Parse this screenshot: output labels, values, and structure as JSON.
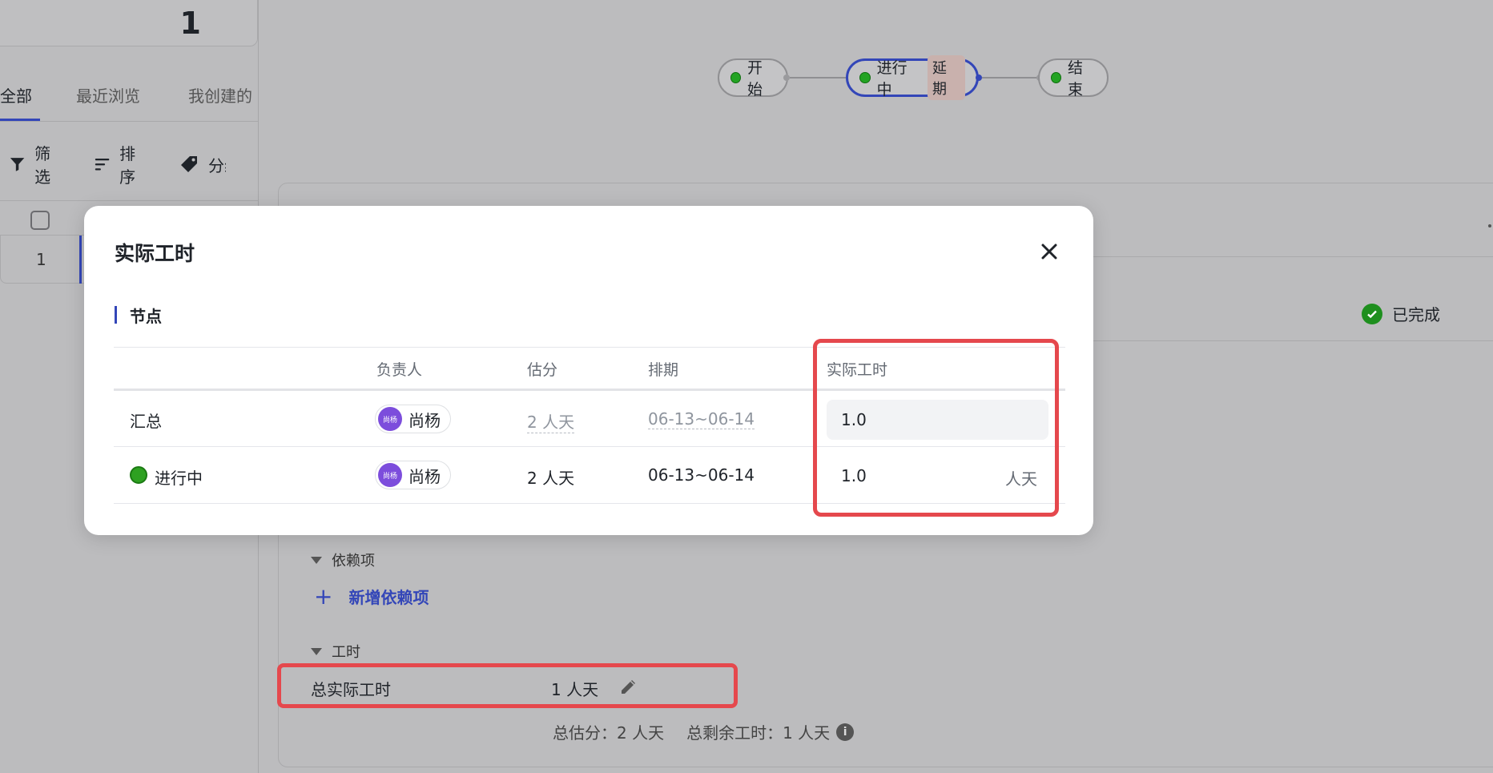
{
  "left": {
    "count": "1",
    "tabs": [
      "全部",
      "最近浏览",
      "我创建的"
    ],
    "toolbar": {
      "filter": "筛选",
      "sort": "排序",
      "group": "分组"
    },
    "row_number": "1"
  },
  "flow": {
    "start": "开始",
    "current": "进行中",
    "current_badge": "延期",
    "end": "结束"
  },
  "detail": {
    "status": "已完成",
    "dependencies_title": "依赖项",
    "add_dependency": "新增依赖项",
    "hours_title": "工时",
    "total_actual_label": "总实际工时",
    "total_actual_value": "1 人天",
    "total_estimate": "总估分：2 人天",
    "total_remaining": "总剩余工时：1 人天"
  },
  "modal": {
    "title": "实际工时",
    "section": "节点",
    "columns": {
      "owner": "负责人",
      "estimate": "估分",
      "schedule": "排期",
      "actual": "实际工时"
    },
    "rows": [
      {
        "name": "汇总",
        "owner": "尚杨",
        "avatar": "尚杨",
        "estimate": "2 人天",
        "schedule": "06-13~06-14",
        "actual": "1.0"
      },
      {
        "name": "进行中",
        "owner": "尚杨",
        "avatar": "尚杨",
        "estimate": "2 人天",
        "schedule": "06-13~06-14",
        "actual": "1.0",
        "unit": "人天"
      }
    ]
  },
  "colors": {
    "accent": "#3346b8",
    "highlight": "#e5484d",
    "status_green": "#2ea121",
    "avatar": "#7c4ddc"
  },
  "icons": [
    "filter-icon",
    "sort-icon",
    "tag-icon",
    "close-icon",
    "check-circle-icon",
    "pencil-icon",
    "info-icon",
    "caret-down-icon",
    "plus-icon"
  ]
}
